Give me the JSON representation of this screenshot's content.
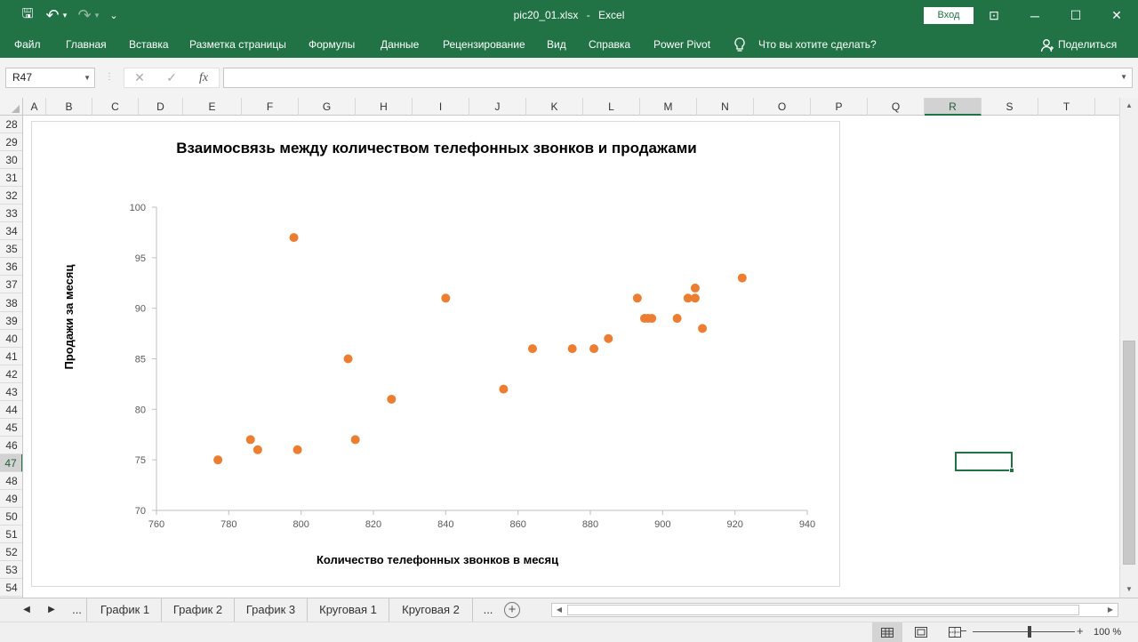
{
  "app": {
    "filename": "pic20_01.xlsx",
    "separator": "-",
    "name": "Excel",
    "signin_label": "Вход",
    "accent_color": "#217346"
  },
  "quick_access": [
    {
      "name": "save-icon",
      "glyph": "🖫"
    },
    {
      "name": "undo-icon",
      "glyph": "↶"
    },
    {
      "name": "undo-dropdown-icon",
      "glyph": "▾"
    },
    {
      "name": "redo-icon",
      "glyph": "↷"
    },
    {
      "name": "redo-dropdown-icon",
      "glyph": "▾"
    },
    {
      "name": "customize-toolbar-icon",
      "glyph": "⌄"
    }
  ],
  "window_controls": [
    {
      "name": "ribbon-display-options-icon",
      "glyph": "⊡"
    },
    {
      "name": "minimize-icon",
      "glyph": "─"
    },
    {
      "name": "maximize-icon",
      "glyph": "☐"
    },
    {
      "name": "close-icon",
      "glyph": "✕"
    }
  ],
  "menu": {
    "items": [
      "Файл",
      "Главная",
      "Вставка",
      "Разметка страницы",
      "Формулы",
      "Данные",
      "Рецензирование",
      "Вид",
      "Справка",
      "Power Pivot"
    ],
    "tell_me_icon": "lightbulb-icon",
    "tell_me": "Что вы хотите сделать?",
    "share_icon": "person-icon",
    "share": "Поделиться"
  },
  "formula_bar": {
    "name_box": "R47",
    "separator_glyph": "⋮",
    "cancel_glyph": "✕",
    "enter_glyph": "✓",
    "function_glyph": "fx",
    "formula": ""
  },
  "grid": {
    "columns": [
      "A",
      "B",
      "C",
      "D",
      "E",
      "F",
      "G",
      "H",
      "I",
      "J",
      "K",
      "L",
      "M",
      "N",
      "O",
      "P",
      "Q",
      "R",
      "S",
      "T"
    ],
    "selected_column": "R",
    "rows": [
      "28",
      "29",
      "30",
      "31",
      "32",
      "33",
      "34",
      "35",
      "36",
      "37",
      "38",
      "39",
      "40",
      "41",
      "42",
      "43",
      "44",
      "45",
      "46",
      "47",
      "48",
      "49",
      "50",
      "51",
      "52",
      "53",
      "54"
    ],
    "selected_row": "47"
  },
  "chart_data": {
    "type": "scatter",
    "title": "Взаимосвязь между количеством телефонных звонков и продажами",
    "xlabel": "Количество телефонных звонков в месяц",
    "ylabel": "Продажи за месяц",
    "xlim": [
      760,
      940
    ],
    "ylim": [
      70,
      100
    ],
    "x_ticks": [
      760,
      780,
      800,
      820,
      840,
      860,
      880,
      900,
      920,
      940
    ],
    "y_ticks": [
      70,
      75,
      80,
      85,
      90,
      95,
      100
    ],
    "grid": false,
    "legend": "none",
    "marker_color": "#ED7D31",
    "points": [
      {
        "x": 777,
        "y": 75
      },
      {
        "x": 786,
        "y": 77
      },
      {
        "x": 788,
        "y": 76
      },
      {
        "x": 798,
        "y": 97
      },
      {
        "x": 799,
        "y": 76
      },
      {
        "x": 813,
        "y": 85
      },
      {
        "x": 815,
        "y": 77
      },
      {
        "x": 825,
        "y": 81
      },
      {
        "x": 840,
        "y": 91
      },
      {
        "x": 856,
        "y": 82
      },
      {
        "x": 864,
        "y": 86
      },
      {
        "x": 875,
        "y": 86
      },
      {
        "x": 881,
        "y": 86
      },
      {
        "x": 885,
        "y": 87
      },
      {
        "x": 893,
        "y": 91
      },
      {
        "x": 895,
        "y": 89
      },
      {
        "x": 896,
        "y": 89
      },
      {
        "x": 897,
        "y": 89
      },
      {
        "x": 904,
        "y": 89
      },
      {
        "x": 907,
        "y": 91
      },
      {
        "x": 909,
        "y": 91
      },
      {
        "x": 909,
        "y": 92
      },
      {
        "x": 911,
        "y": 88
      },
      {
        "x": 922,
        "y": 93
      }
    ]
  },
  "sheet_tabs": {
    "nav_prev": "◀",
    "nav_next": "▶",
    "ellipsis": "...",
    "tabs": [
      "График 1",
      "График 2",
      "График 3",
      "Круговая 1",
      "Круговая 2"
    ],
    "add_glyph": "+"
  },
  "status": {
    "zoom": "100 %",
    "zoom_minus": "−",
    "zoom_plus": "+"
  }
}
